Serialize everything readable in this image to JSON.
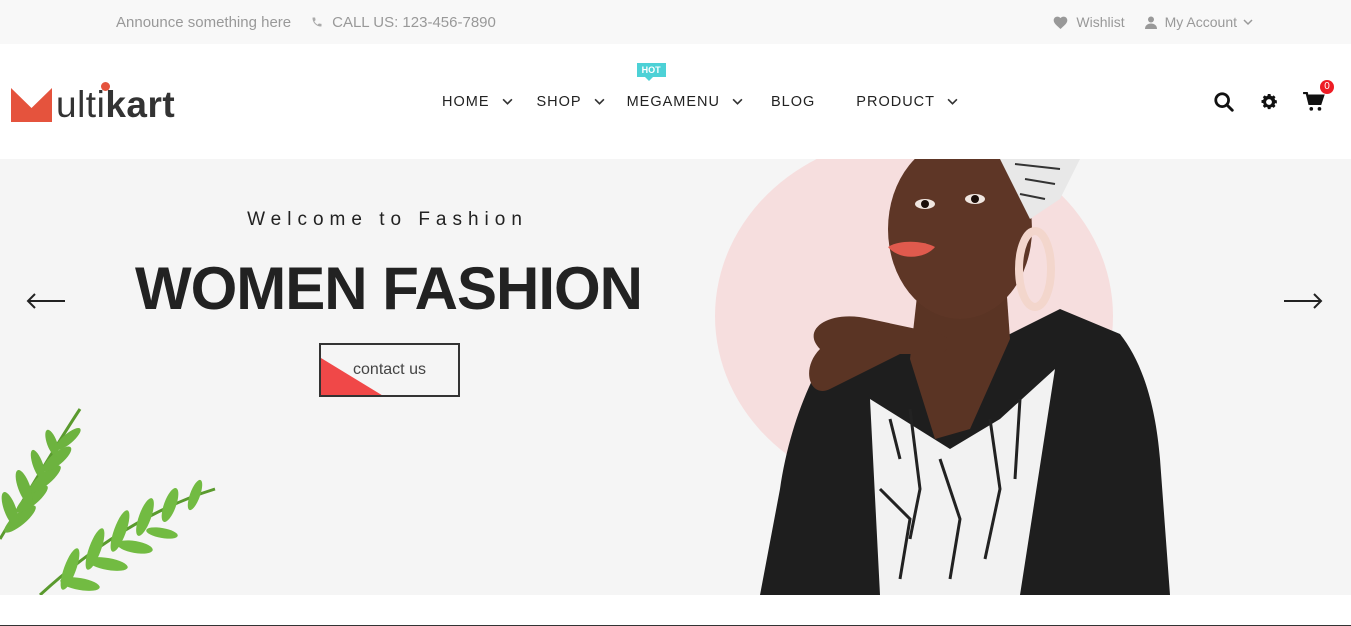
{
  "topbar": {
    "announcement": "Announce something here",
    "phone": "CALL US: 123-456-7890",
    "wishlist": "Wishlist",
    "account": "My Account"
  },
  "logo": {
    "text_light": "ulti",
    "text_bold": "kart",
    "accent_color": "#e5533d"
  },
  "nav": {
    "items": [
      {
        "label": "HOME",
        "has_dropdown": true
      },
      {
        "label": "SHOP",
        "has_dropdown": true
      },
      {
        "label": "MEGAMENU",
        "has_dropdown": true,
        "badge": "HOT"
      },
      {
        "label": "BLOG",
        "has_dropdown": false
      },
      {
        "label": "PRODUCT",
        "has_dropdown": true
      }
    ]
  },
  "header_icons": {
    "search": "search-icon",
    "settings": "gear-icon",
    "cart": "cart-icon",
    "cart_count": "0"
  },
  "hero": {
    "subtitle": "Welcome to Fashion",
    "title": "WOMEN FASHION",
    "cta_label": "contact us",
    "cta_accent": "#f04848"
  }
}
